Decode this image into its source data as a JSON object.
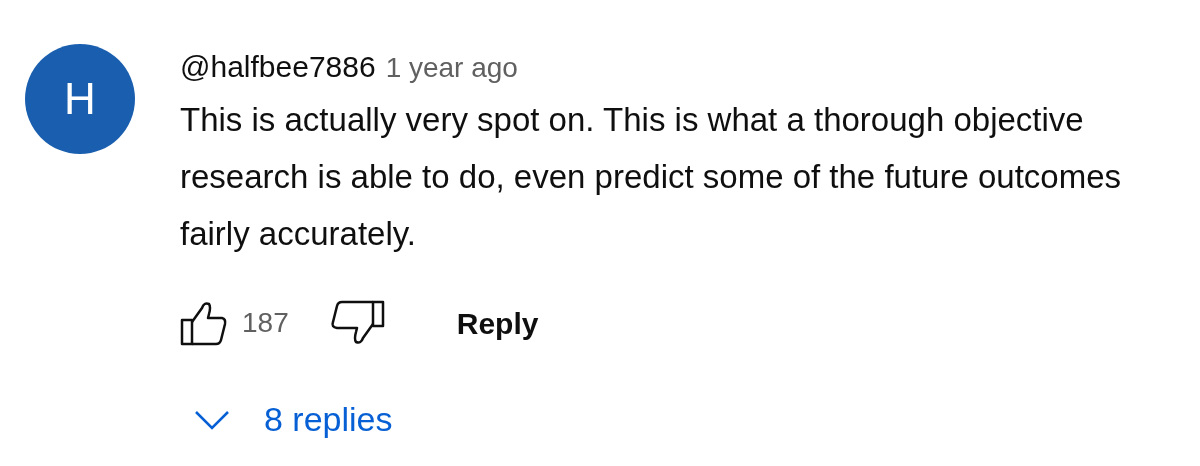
{
  "comment": {
    "avatar_letter": "H",
    "author": "@halfbee7886",
    "time": "1 year ago",
    "text": "This is actually very spot on. This is what a thorough objective research is able to do, even predict some of the future outcomes fairly accurately.",
    "likes": "187",
    "reply_label": "Reply",
    "replies_label": "8 replies",
    "replies_expanded": false
  }
}
